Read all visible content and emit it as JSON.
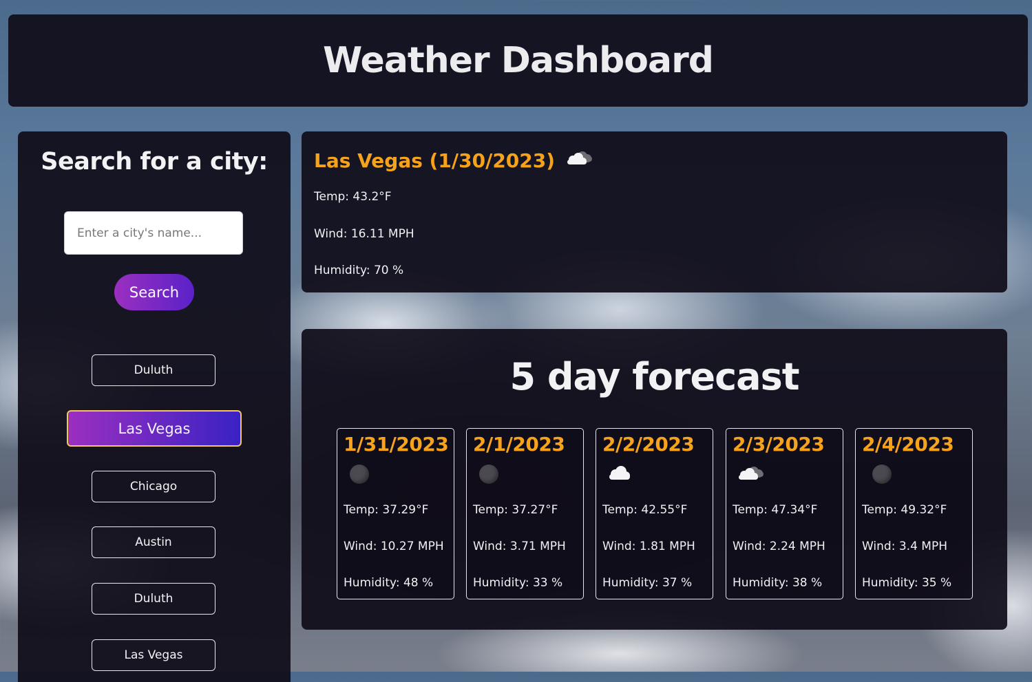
{
  "header": {
    "title": "Weather Dashboard"
  },
  "sidebar": {
    "title": "Search for a city:",
    "search": {
      "placeholder": "Enter a city's name...",
      "value": ""
    },
    "search_button": "Search",
    "history": [
      "Duluth",
      "Las Vegas",
      "Chicago",
      "Austin",
      "Duluth",
      "Las Vegas"
    ],
    "active_history_index": 1
  },
  "current": {
    "title": "Las Vegas (1/30/2023)",
    "icon": "broken-clouds-icon",
    "temp": "Temp: 43.2°F",
    "wind": "Wind: 16.11 MPH",
    "humidity": "Humidity: 70 %"
  },
  "forecast": {
    "title": "5 day forecast",
    "days": [
      {
        "date": "1/31/2023",
        "icon": "clear-night-icon",
        "temp": "Temp: 37.29°F",
        "wind": "Wind: 10.27 MPH",
        "humidity": "Humidity: 48 %"
      },
      {
        "date": "2/1/2023",
        "icon": "clear-night-icon",
        "temp": "Temp: 37.27°F",
        "wind": "Wind: 3.71 MPH",
        "humidity": "Humidity: 33 %"
      },
      {
        "date": "2/2/2023",
        "icon": "cloud-icon",
        "temp": "Temp: 42.55°F",
        "wind": "Wind: 1.81 MPH",
        "humidity": "Humidity: 37 %"
      },
      {
        "date": "2/3/2023",
        "icon": "broken-clouds-icon",
        "temp": "Temp: 47.34°F",
        "wind": "Wind: 2.24 MPH",
        "humidity": "Humidity: 38 %"
      },
      {
        "date": "2/4/2023",
        "icon": "clear-night-icon",
        "temp": "Temp: 49.32°F",
        "wind": "Wind: 3.4 MPH",
        "humidity": "Humidity: 35 %"
      }
    ]
  },
  "colors": {
    "accent": "#f7a21b",
    "panel": "#100d1a",
    "button_start": "#9b2fc0",
    "button_end": "#5a22c8",
    "active_border": "#f2c85a"
  }
}
